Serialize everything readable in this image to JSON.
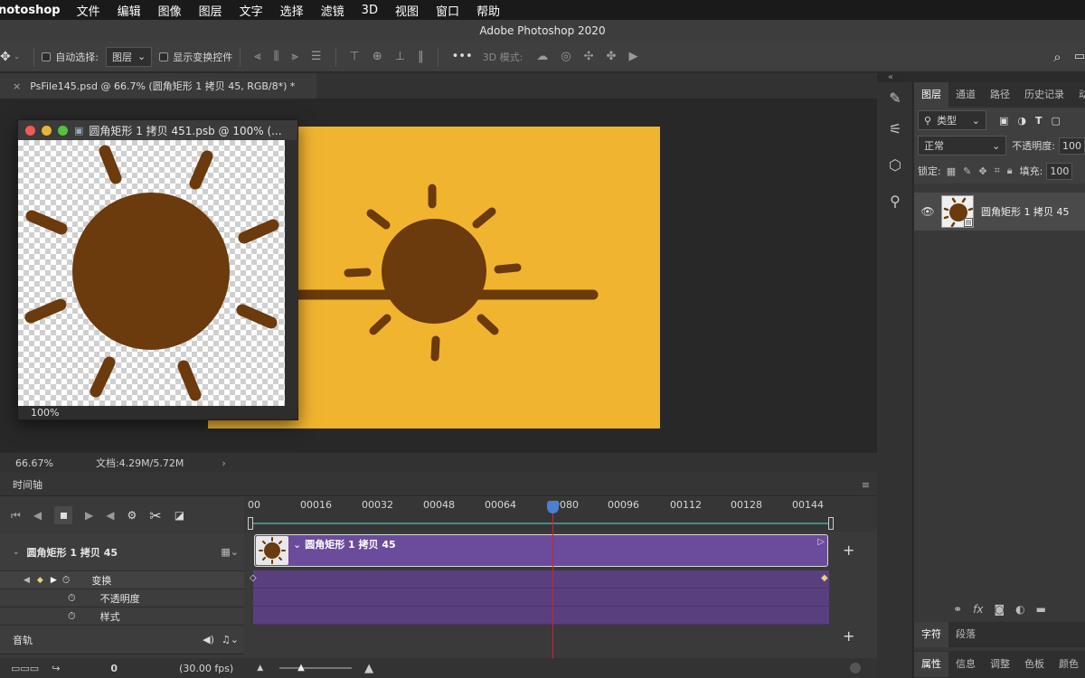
{
  "menubar": {
    "app": "notoshop",
    "items": [
      "文件",
      "编辑",
      "图像",
      "图层",
      "文字",
      "选择",
      "滤镜",
      "3D",
      "视图",
      "窗口",
      "帮助"
    ]
  },
  "window_title": "Adobe Photoshop 2020",
  "options": {
    "auto_select_label": "自动选择:",
    "auto_select_value": "图层",
    "show_transform_label": "显示变换控件",
    "mode_3d_label": "3D 模式:"
  },
  "document": {
    "tab_title": "PsFile145.psd @ 66.7% (圆角矩形 1 拷贝 45, RGB/8*) *",
    "zoom": "66.67%",
    "doc_info": "文档:4.29M/5.72M"
  },
  "float_window": {
    "title": "圆角矩形 1 拷贝 451.psb @ 100% (...",
    "zoom": "100%"
  },
  "timeline": {
    "panel_title": "时间轴",
    "ruler": [
      "00",
      "00016",
      "00032",
      "00048",
      "00064",
      "00080",
      "00096",
      "00112",
      "00128",
      "00144"
    ],
    "layer_name": "圆角矩形 1 拷贝 45",
    "clip_name": "圆角矩形 1 拷贝 45",
    "props": [
      "变换",
      "不透明度",
      "样式"
    ],
    "audio_label": "音轨",
    "frame": "0",
    "fps": "(30.00 fps)"
  },
  "layers_panel": {
    "tabs": [
      "图层",
      "通道",
      "路径",
      "历史记录",
      "动"
    ],
    "filter_label": "类型",
    "blend_mode": "正常",
    "opacity_label": "不透明度:",
    "opacity_value": "100",
    "lock_label": "锁定:",
    "fill_label": "填充:",
    "fill_value": "100",
    "layer_name": "圆角矩形 1 拷贝 45"
  },
  "bottom_tabs_1": [
    "字符",
    "段落"
  ],
  "bottom_tabs_2": [
    "属性",
    "信息",
    "调整",
    "色板",
    "颜色"
  ],
  "colors": {
    "artboard": "#f0b42f",
    "sun": "#6b3a0d",
    "clip": "#6b4b9b",
    "playhead": "#4b7fd4"
  }
}
